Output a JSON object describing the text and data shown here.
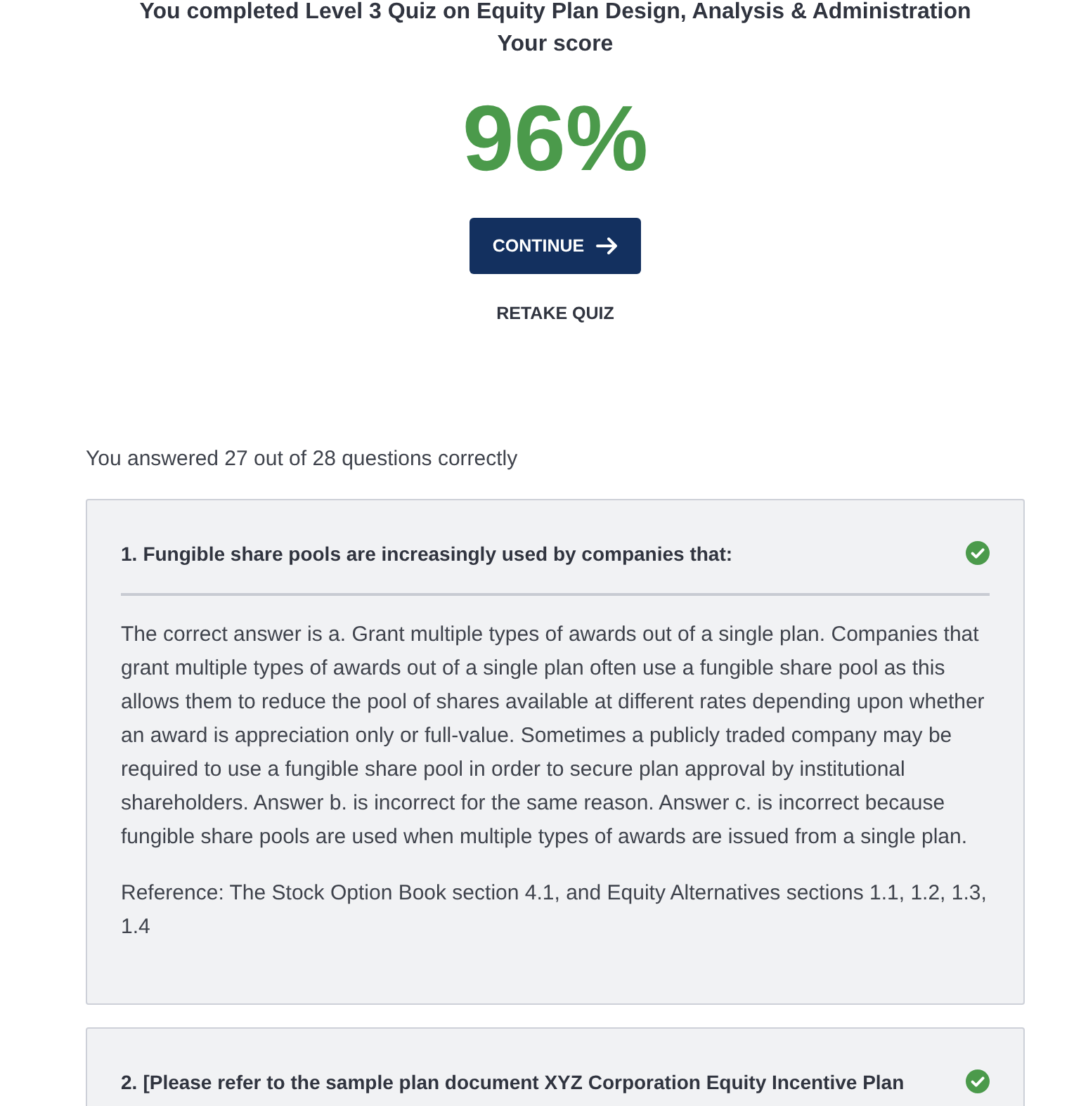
{
  "header": {
    "title": "You completed Level 3 Quiz on Equity Plan Design, Analysis & Administration",
    "subtitle": "Your score"
  },
  "score": "96%",
  "actions": [
    {
      "kind": "primary",
      "label": "CONTINUE"
    },
    {
      "kind": "link",
      "label": "RETAKE QUIZ"
    }
  ],
  "summary": "You answered 27 out of 28 questions correctly",
  "questions": [
    {
      "number": "1.",
      "text": "Fungible share pools are increasingly used by companies that:",
      "correct": true,
      "paragraphs": [
        "The correct answer is a. Grant multiple types of awards out of a single plan. Companies that grant multiple types of awards out of a single plan often use a fungible share pool as this allows them to reduce the pool of shares available at different rates depending upon whether an award is appreciation only or full-value. Sometimes a publicly traded company may be required to use a fungible share pool in order to secure plan approval by institutional shareholders. Answer b. is incorrect for the same reason. Answer c. is incorrect because fungible share pools are used when multiple types of awards are issued from a single plan.",
        "Reference: The Stock Option Book section 4.1, and Equity Alternatives sections 1.1, 1.2, 1.3, 1.4"
      ]
    },
    {
      "number": "2.",
      "text": "[Please refer to the sample plan document XYZ Corporation Equity Incentive Plan",
      "correct": true
    }
  ]
}
